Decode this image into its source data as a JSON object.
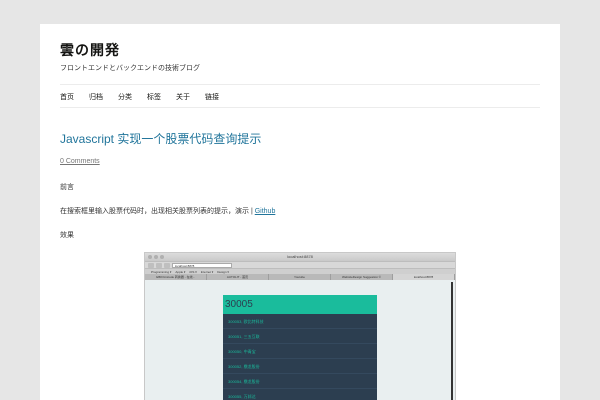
{
  "site": {
    "title": "雲の開発",
    "description": "フロントエンドとバックエンドの技術ブログ"
  },
  "nav": [
    "首页",
    "归档",
    "分类",
    "标签",
    "关于",
    "链接"
  ],
  "post": {
    "title": "Javascript 实现一个股票代码查询提示",
    "comments": "0 Comments",
    "para1": "前言",
    "para2_text": "在搜索框里输入股票代码时，出现相关股票列表的提示，演示 | ",
    "para2_link": "Github",
    "para3": "效果"
  },
  "screenshot": {
    "window_title": "localhost:8878",
    "url": "localhost:8878",
    "bookmarks": [
      "Programming ▾",
      "Apple ▾",
      "iOS ▾",
      "Internet ▾",
      "Design ▾"
    ],
    "tabs": [
      "GBK/Unicode 转换器 - 在线...",
      "AUTOLIT - 首页",
      "Youtube",
      "WebsiteDesign Suggestion ©",
      "localhost:8878"
    ],
    "active_tab_index": 4,
    "app_header": "30005",
    "app_items": [
      "300053, 欧比特科技",
      "300051, 三五互联",
      "300050, 中青宝",
      "300052, 鼎龙股份",
      "300054, 鼎龙股份",
      "300055, 万邦达"
    ]
  },
  "colors": {
    "link": "#21759b",
    "app_accent": "#1abc9c",
    "app_bg": "#2c3e50"
  }
}
